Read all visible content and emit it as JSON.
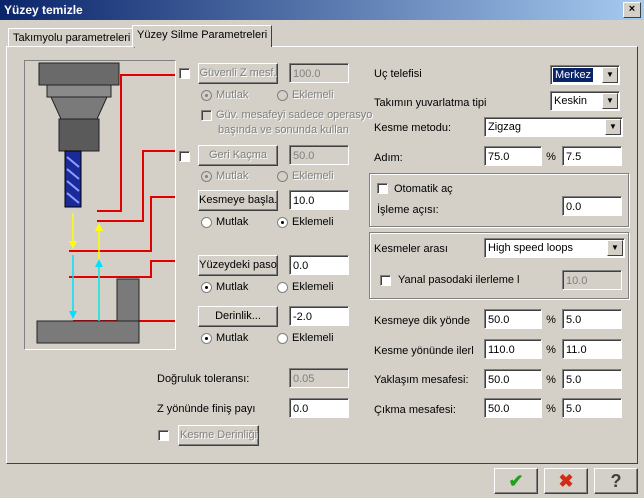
{
  "window": {
    "title": "Yüzey temizle",
    "close_glyph": "×"
  },
  "tabs": [
    {
      "label": "Takımyolu parametreleri"
    },
    {
      "label": "Yüzey Silme Parametreleri"
    }
  ],
  "left": {
    "guvenli": {
      "label": "Güvenli Z mesf.",
      "value": "100.0",
      "mutlak": "Mutlak",
      "eklemeli": "Eklemeli",
      "note1": "Güv. mesafeyi sadece operasyo",
      "note2": "başında ve sonunda kullan"
    },
    "geri": {
      "label": "Geri Kaçma",
      "value": "50.0",
      "mutlak": "Mutlak",
      "eklemeli": "Eklemeli"
    },
    "kesmeye": {
      "label": "Kesmeye başla.",
      "value": "10.0",
      "mutlak": "Mutlak",
      "eklemeli": "Eklemeli"
    },
    "yuzey": {
      "label": "Yüzeydeki paso",
      "value": "0.0",
      "mutlak": "Mutlak",
      "eklemeli": "Eklemeli"
    },
    "derinlik": {
      "label": "Derinlik...",
      "value": "-2.0",
      "mutlak": "Mutlak",
      "eklemeli": "Eklemeli"
    },
    "dogruluk": {
      "label": "Doğruluk toleransı:",
      "value": "0.05"
    },
    "z_finis": {
      "label": "Z yönünde finiş payı",
      "value": "0.0"
    },
    "kesme_derinligi": {
      "label": "Kesme Derinliği"
    }
  },
  "right": {
    "uc_telefisi": {
      "label": "Uç telefisi",
      "value": "Merkez"
    },
    "yuvarlatma": {
      "label": "Takımın yuvarlatma tipi",
      "value": "Keskin"
    },
    "kesme_metodu": {
      "label": "Kesme metodu:",
      "value": "Zigzag"
    },
    "adim": {
      "label": "Adım:",
      "value1": "75.0",
      "value2": "7.5",
      "pct": "%"
    },
    "otomatik": {
      "label": "Otomatik aç"
    },
    "isleme_acisi": {
      "label": "İşleme açısı:",
      "value": "0.0"
    },
    "kesmeler_arasi": {
      "label": "Kesmeler arası",
      "value": "High speed loops"
    },
    "yanal": {
      "label": "Yanal pasodaki ilerleme l",
      "value": "10.0"
    },
    "dik_yonde": {
      "label": "Kesmeye dik yönde",
      "value1": "50.0",
      "value2": "5.0",
      "pct": "%"
    },
    "ilerleme": {
      "label": "Kesme yönünde ilerl",
      "value1": "110.0",
      "value2": "11.0",
      "pct": "%"
    },
    "yaklasim": {
      "label": "Yaklaşım mesafesi:",
      "value1": "50.0",
      "value2": "5.0",
      "pct": "%"
    },
    "cikma": {
      "label": "Çıkma mesafesi:",
      "value1": "50.0",
      "value2": "5.0",
      "pct": "%"
    }
  },
  "buttons": {
    "ok": "✔",
    "cancel": "✖",
    "help": "?"
  },
  "colors": {
    "title_start": "#0a246a",
    "ok_green": "#22a022",
    "cancel_red": "#d42a18",
    "guide_red": "#e00000",
    "arrow_yellow": "#ffff00",
    "arrow_cyan": "#00e0ff"
  }
}
